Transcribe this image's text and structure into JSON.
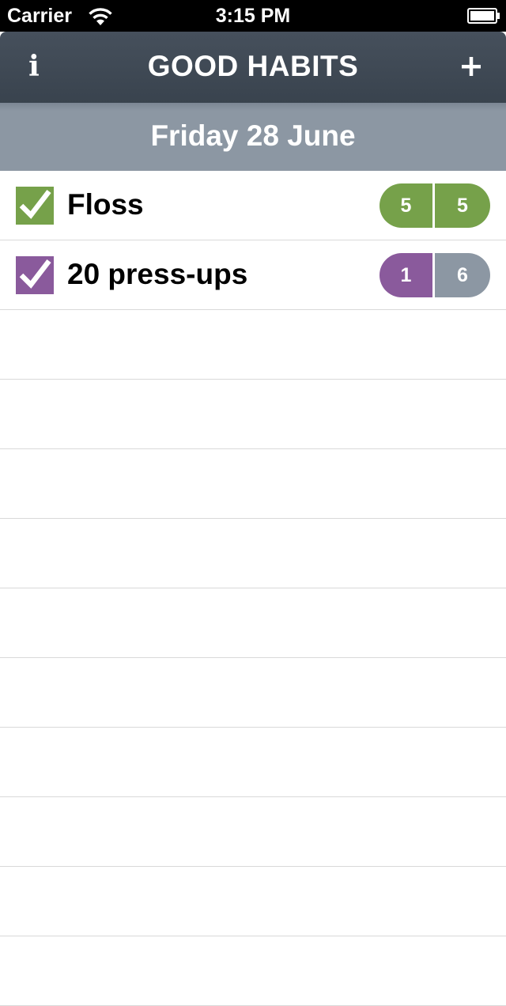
{
  "status_bar": {
    "carrier": "Carrier",
    "time": "3:15 PM",
    "wifi_icon": "wifi-icon",
    "battery_icon": "battery-icon"
  },
  "nav": {
    "title": "GOOD HABITS",
    "info_label": "i",
    "add_icon": "plus-icon"
  },
  "date": "Friday 28 June",
  "colors": {
    "green": "#76a14a",
    "purple": "#8a5a9c",
    "gray": "#8c97a3",
    "nav": "#3d4752"
  },
  "habits": [
    {
      "name": "Floss",
      "checked": true,
      "color": "#76a14a",
      "count_left": "5",
      "count_right": "5",
      "left_color": "#76a14a",
      "right_color": "#76a14a"
    },
    {
      "name": "20 press-ups",
      "checked": true,
      "color": "#8a5a9c",
      "count_left": "1",
      "count_right": "6",
      "left_color": "#8a5a9c",
      "right_color": "#8c97a3"
    }
  ]
}
